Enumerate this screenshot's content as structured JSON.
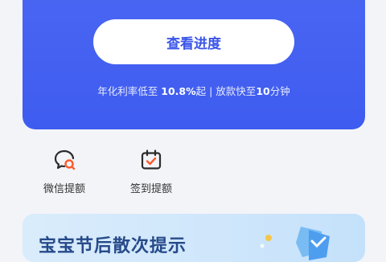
{
  "hero": {
    "progress_button": "查看进度",
    "rate_prefix": "年化利率低至",
    "rate_value": "10.8%",
    "rate_suffix": "起 | 放款快至",
    "loan_value": "10",
    "loan_suffix": "分钟"
  },
  "quick_actions": [
    {
      "label": "微信提额",
      "icon": "wechat-chat-icon"
    },
    {
      "label": "签到提额",
      "icon": "calendar-check-icon"
    }
  ],
  "promo": {
    "title": "宝宝节后散次提示"
  },
  "colors": {
    "brand": "#3e5cf0",
    "accent": "#ff5a2c"
  }
}
